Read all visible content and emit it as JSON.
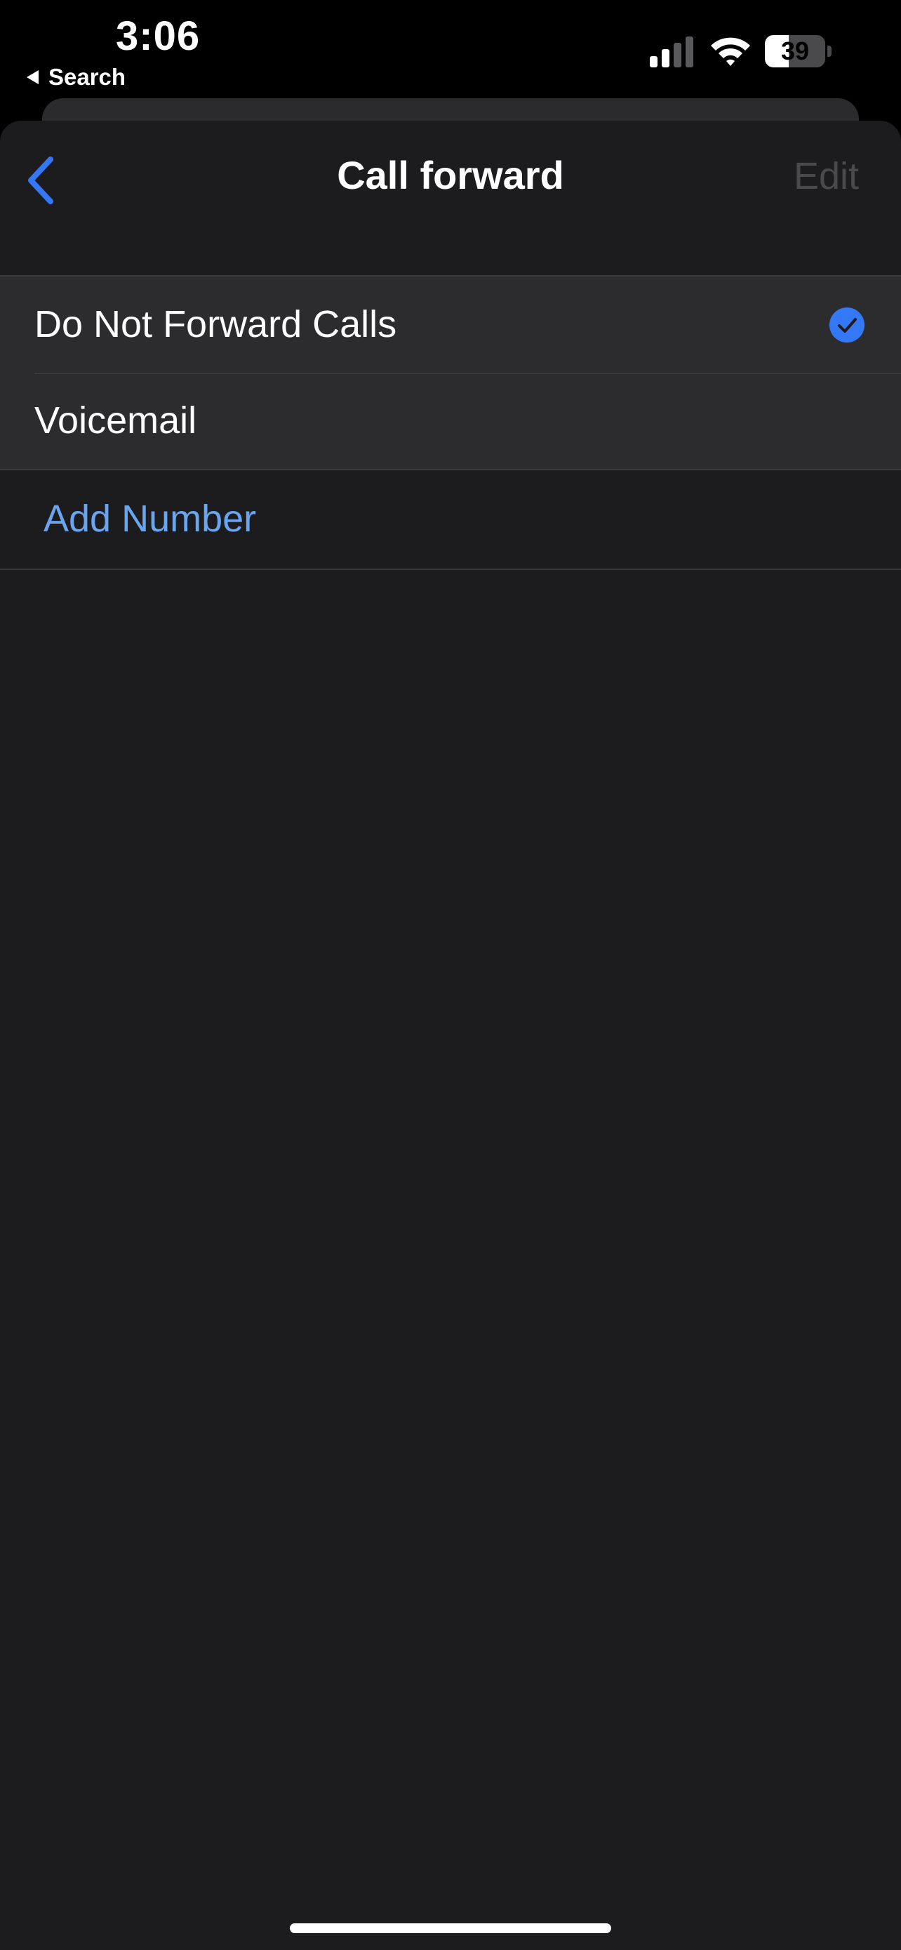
{
  "status_bar": {
    "time": "3:06",
    "back_app": "Search",
    "battery_level": "39",
    "battery_fraction": 0.39
  },
  "nav": {
    "title": "Call forward",
    "edit_label": "Edit",
    "back_icon": "chevron-left-icon"
  },
  "forward_options": [
    {
      "label": "Do Not Forward Calls",
      "selected": true
    },
    {
      "label": "Voicemail",
      "selected": false
    }
  ],
  "add_number_label": "Add Number",
  "colors": {
    "accent": "#3478f6",
    "link": "#6aa5ee",
    "edit_disabled": "#4a4a4c",
    "sheet_background": "#1c1c1e",
    "row_background": "#2c2c2e"
  }
}
